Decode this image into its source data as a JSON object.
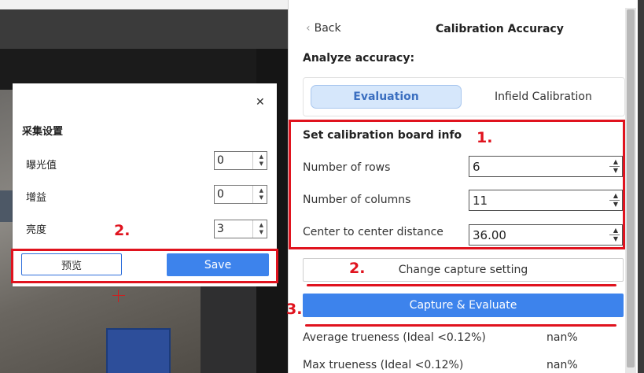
{
  "dialog": {
    "title": "采集设置",
    "close_glyph": "✕",
    "fields": [
      {
        "label": "曝光值",
        "value": "0"
      },
      {
        "label": "增益",
        "value": "0"
      },
      {
        "label": "亮度",
        "value": "3"
      }
    ],
    "preview_label": "预览",
    "save_label": "Save"
  },
  "panel": {
    "back_glyph": "‹",
    "back_label": "Back",
    "title": "Calibration Accuracy",
    "analyze_label": "Analyze accuracy:",
    "tabs": [
      {
        "label": "Evaluation",
        "active": true
      },
      {
        "label": "Infield Calibration",
        "active": false
      }
    ],
    "board": {
      "title": "Set calibration board info",
      "fields": [
        {
          "label": "Number of rows",
          "value": "6"
        },
        {
          "label": "Number of columns",
          "value": "11"
        },
        {
          "label": "Center to center distance",
          "value": "36.00"
        }
      ]
    },
    "change_capture_label": "Change capture setting",
    "capture_evaluate_label": "Capture & Evaluate",
    "results": [
      {
        "label": "Average trueness (Ideal <0.12%)",
        "value": "nan%"
      },
      {
        "label": "Max trueness (Ideal <0.12%)",
        "value": "nan%"
      }
    ]
  },
  "annotations": {
    "marker_1": "1.",
    "marker_2_dialog": "2.",
    "marker_2_panel": "2.",
    "marker_3": "3."
  },
  "colors": {
    "accent_blue": "#3d83ec",
    "annotation_red": "#e0131e",
    "active_tab_bg": "#d6e7fb"
  },
  "icons": {
    "spin_up": "▲",
    "spin_down": "▼"
  }
}
